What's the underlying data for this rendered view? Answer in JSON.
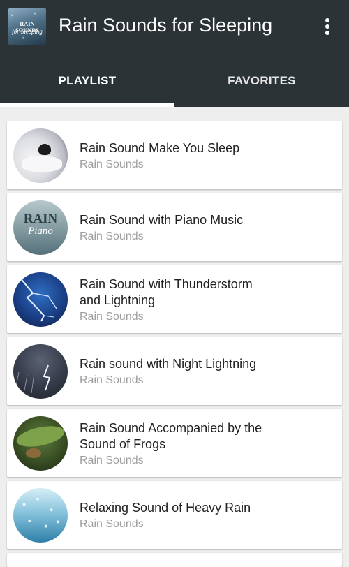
{
  "app": {
    "title": "Rain Sounds for Sleeping",
    "icon_line1": "RAIN SOUNDS",
    "icon_line2": "for Sleeping"
  },
  "tabs": [
    {
      "label": "PLAYLIST",
      "selected": true
    },
    {
      "label": "FAVORITES",
      "selected": false
    }
  ],
  "tracks": [
    {
      "title_lines": [
        "Rain Sound Make You Sleep"
      ],
      "subtitle": "Rain Sounds",
      "thumb": "sleeping-woman-image"
    },
    {
      "title_lines": [
        "Rain Sound with Piano Music"
      ],
      "subtitle": "Rain Sounds",
      "thumb": "rain-piano-image",
      "thumb_line1": "RAIN",
      "thumb_line2": "Piano"
    },
    {
      "title_lines": [
        "Rain Sound with Thunderstorm",
        "and Lightning"
      ],
      "subtitle": "Rain Sounds",
      "thumb": "lightning-image"
    },
    {
      "title_lines": [
        "Rain sound with Night Lightning"
      ],
      "subtitle": "Rain Sounds",
      "thumb": "night-storm-image"
    },
    {
      "title_lines": [
        "Rain Sound Accompanied by the",
        "Sound of Frogs"
      ],
      "subtitle": "Rain Sounds",
      "thumb": "frog-image"
    },
    {
      "title_lines": [
        "Relaxing Sound of Heavy Rain"
      ],
      "subtitle": "Rain Sounds",
      "thumb": "rain-window-image"
    }
  ],
  "colors": {
    "appbar": "#2b3337",
    "background": "#eeeeee",
    "title_text": "#212121",
    "subtitle_text": "#9e9e9e"
  }
}
